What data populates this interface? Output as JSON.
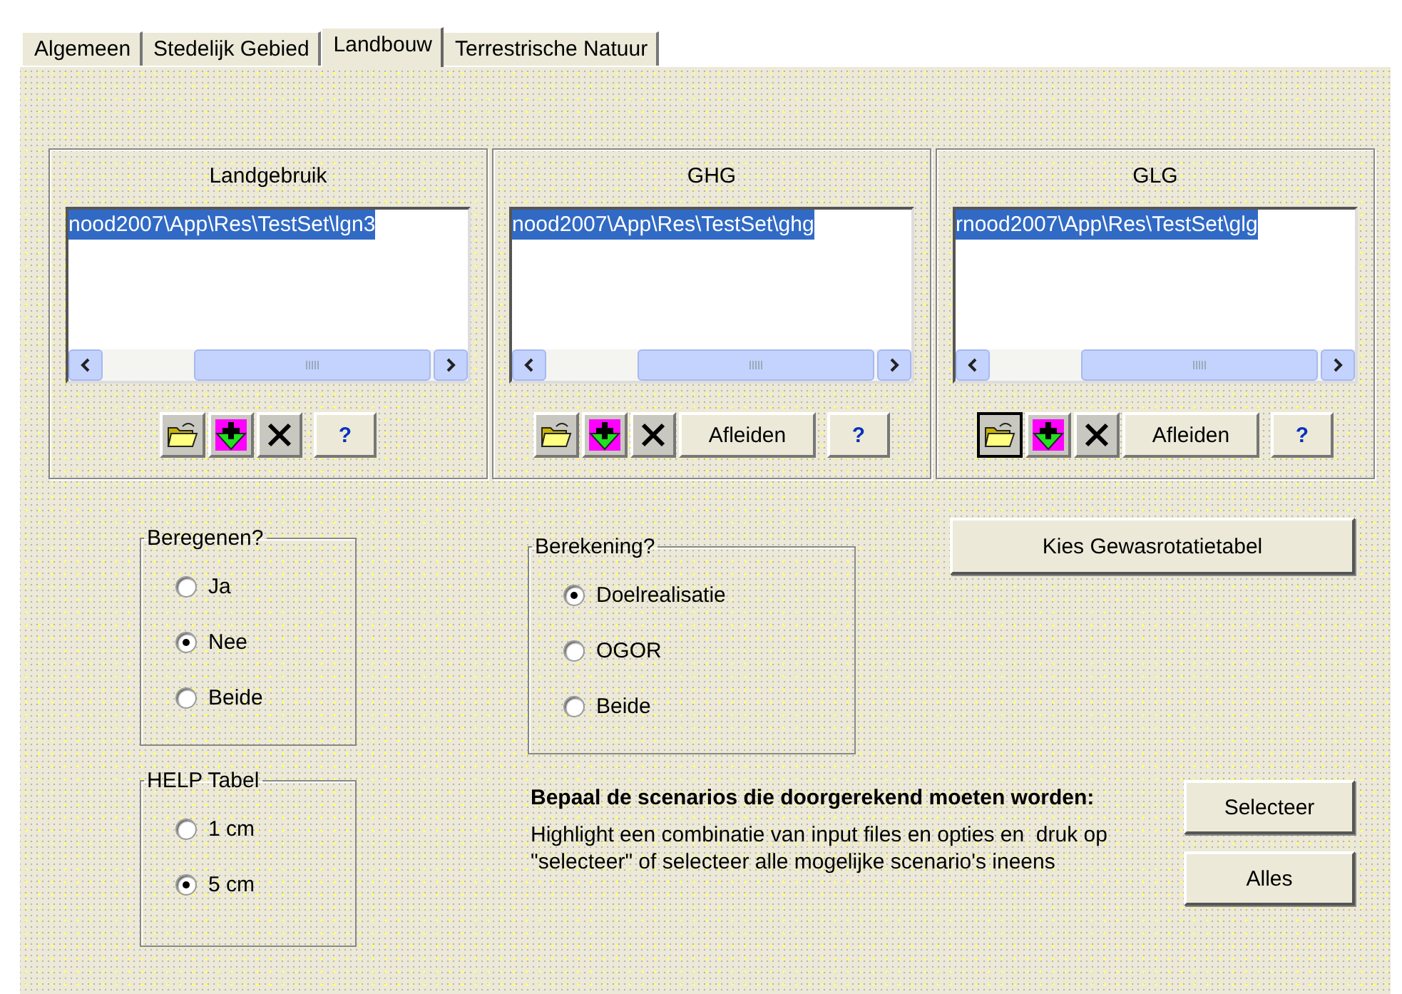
{
  "tabs": [
    {
      "label": "Algemeen",
      "selected": false
    },
    {
      "label": "Stedelijk Gebied",
      "selected": false
    },
    {
      "label": "Landbouw",
      "selected": true
    },
    {
      "label": "Terrestrische Natuur",
      "selected": false
    }
  ],
  "file_groups": [
    {
      "title": "Landgebruik",
      "list_items": [
        {
          "text": "nood2007\\App\\Res\\TestSet\\lgn3",
          "selected": true
        }
      ],
      "tools": [
        {
          "kind": "open",
          "focused": false
        },
        {
          "kind": "add",
          "focused": false
        },
        {
          "kind": "delete",
          "focused": false
        },
        {
          "kind": "help",
          "label": "?",
          "focused": false
        }
      ]
    },
    {
      "title": "GHG",
      "list_items": [
        {
          "text": "nood2007\\App\\Res\\TestSet\\ghg",
          "selected": true
        }
      ],
      "tools": [
        {
          "kind": "open",
          "focused": false
        },
        {
          "kind": "add",
          "focused": false
        },
        {
          "kind": "delete",
          "focused": false
        },
        {
          "kind": "derive",
          "label": "Afleiden",
          "focused": false
        },
        {
          "kind": "help",
          "label": "?",
          "focused": false
        }
      ]
    },
    {
      "title": "GLG",
      "list_items": [
        {
          "text": "rnood2007\\App\\Res\\TestSet\\glg",
          "selected": true
        }
      ],
      "tools": [
        {
          "kind": "open",
          "focused": true
        },
        {
          "kind": "add",
          "focused": false
        },
        {
          "kind": "delete",
          "focused": false
        },
        {
          "kind": "derive",
          "label": "Afleiden",
          "focused": false
        },
        {
          "kind": "help",
          "label": "?",
          "focused": false
        }
      ]
    }
  ],
  "irrigation_group": {
    "title": "Beregenen?",
    "options": [
      {
        "label": "Ja",
        "selected": false
      },
      {
        "label": "Nee",
        "selected": true
      },
      {
        "label": "Beide",
        "selected": false
      }
    ]
  },
  "calculation_group": {
    "title": "Berekening?",
    "options": [
      {
        "label": "Doelrealisatie",
        "selected": true
      },
      {
        "label": "OGOR",
        "selected": false
      },
      {
        "label": "Beide",
        "selected": false
      }
    ]
  },
  "rotation_button": {
    "label": "Kies Gewasrotatietabel"
  },
  "help_table_group": {
    "title": "HELP Tabel",
    "options": [
      {
        "label": "1 cm",
        "selected": false
      },
      {
        "label": "5 cm",
        "selected": true
      }
    ]
  },
  "scenario_info": {
    "heading": "Bepaal de scenarios die doorgerekend moeten worden:",
    "text": "Highlight een combinatie van input files en opties en  druk op \"selecteer\" of selecteer alle mogelijke scenario's ineens"
  },
  "action_buttons": [
    {
      "label": "Selecteer"
    },
    {
      "label": "Alles"
    }
  ]
}
